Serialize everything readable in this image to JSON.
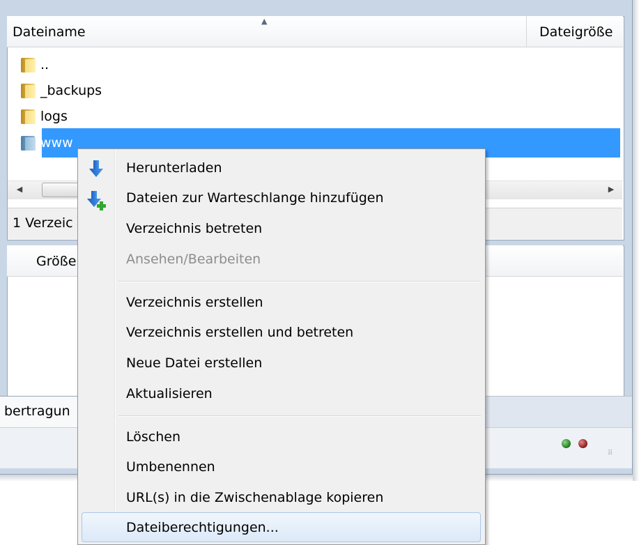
{
  "file_list": {
    "columns": {
      "name": "Dateiname",
      "size": "Dateigröße"
    },
    "rows": [
      {
        "name": "..",
        "selected": false
      },
      {
        "name": "_backups",
        "selected": false
      },
      {
        "name": "logs",
        "selected": false
      },
      {
        "name": "www",
        "selected": true
      }
    ],
    "status": "1 Verzeic"
  },
  "queue": {
    "columns": {
      "size": "Größe"
    },
    "tab_label": "bertragun"
  },
  "status_leds": {
    "green": "#1d7a1b",
    "red": "#8c1818"
  },
  "context_menu": {
    "items": [
      {
        "label": "Herunterladen",
        "icon": "download-arrow-icon",
        "disabled": false
      },
      {
        "label": "Dateien zur Warteschlange hinzufügen",
        "icon": "add-to-queue-icon",
        "disabled": false
      },
      {
        "label": "Verzeichnis betreten",
        "disabled": false
      },
      {
        "label": "Ansehen/Bearbeiten",
        "disabled": true
      },
      {
        "label": "Verzeichnis erstellen",
        "disabled": false
      },
      {
        "label": "Verzeichnis erstellen und betreten",
        "disabled": false
      },
      {
        "label": "Neue Datei erstellen",
        "disabled": false
      },
      {
        "label": "Aktualisieren",
        "disabled": false
      },
      {
        "label": "Löschen",
        "disabled": false
      },
      {
        "label": "Umbenennen",
        "disabled": false
      },
      {
        "label": "URL(s) in die Zwischenablage kopieren",
        "disabled": false
      },
      {
        "label": "Dateiberechtigungen...",
        "disabled": false,
        "hovered": true
      }
    ]
  },
  "colors": {
    "selection": "#3399ff",
    "menu_bg": "#f0f0f0",
    "disabled_text": "#8d8d8d"
  }
}
